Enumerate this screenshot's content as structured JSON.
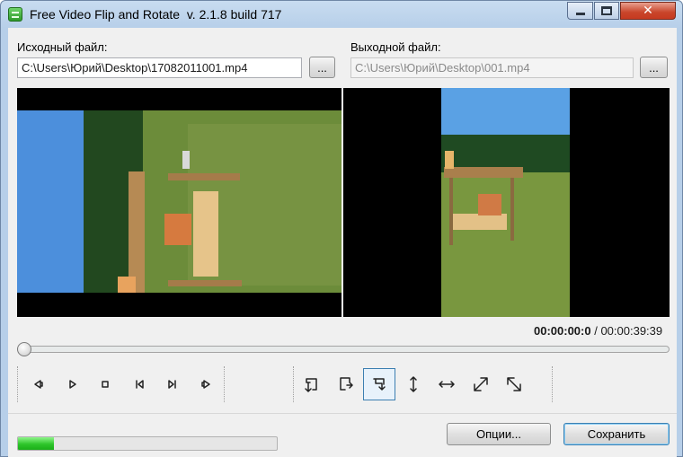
{
  "window": {
    "title": "Free Video Flip and Rotate  v. 2.1.8 build 717",
    "icons": {
      "app": "app-icon",
      "minimize": "minimize-icon",
      "maximize": "maximize-icon",
      "close": "close-icon"
    }
  },
  "input": {
    "label": "Исходный файл:",
    "value": "C:\\Users\\Юрий\\Desktop\\17082011001.mp4",
    "browse_label": "..."
  },
  "output": {
    "label": "Выходной файл:",
    "value": "C:\\Users\\Юрий\\Desktop\\001.mp4",
    "browse_label": "..."
  },
  "playback": {
    "current_time": "00:00:00:0",
    "separator": " / ",
    "total_time": "00:00:39:39",
    "position": 0
  },
  "player_controls": [
    {
      "name": "previous-frame-icon",
      "glyph": "prev"
    },
    {
      "name": "play-icon",
      "glyph": "play"
    },
    {
      "name": "stop-icon",
      "glyph": "stop"
    },
    {
      "name": "skip-start-icon",
      "glyph": "skipstart"
    },
    {
      "name": "skip-end-icon",
      "glyph": "skipend"
    },
    {
      "name": "next-frame-icon",
      "glyph": "next"
    }
  ],
  "transform_controls": [
    {
      "name": "rotate-ccw-icon",
      "glyph": "rotl",
      "active": false
    },
    {
      "name": "rotate-cw-icon",
      "glyph": "rotr",
      "active": false
    },
    {
      "name": "rotate-down-icon",
      "glyph": "rotd",
      "active": true
    },
    {
      "name": "flip-vertical-icon",
      "glyph": "flipv",
      "active": false
    },
    {
      "name": "flip-horizontal-icon",
      "glyph": "fliph",
      "active": false
    },
    {
      "name": "diagonal-ne-icon",
      "glyph": "diag1",
      "active": false
    },
    {
      "name": "diagonal-nw-icon",
      "glyph": "diag2",
      "active": false
    }
  ],
  "buttons": {
    "options": "Опции...",
    "save": "Сохранить"
  },
  "progress": {
    "value": 0.14,
    "color": "#2ec52a"
  },
  "colors": {
    "accent": "#3c7fb1",
    "window_frame": "#b7cfe9",
    "close": "#c63a20"
  }
}
